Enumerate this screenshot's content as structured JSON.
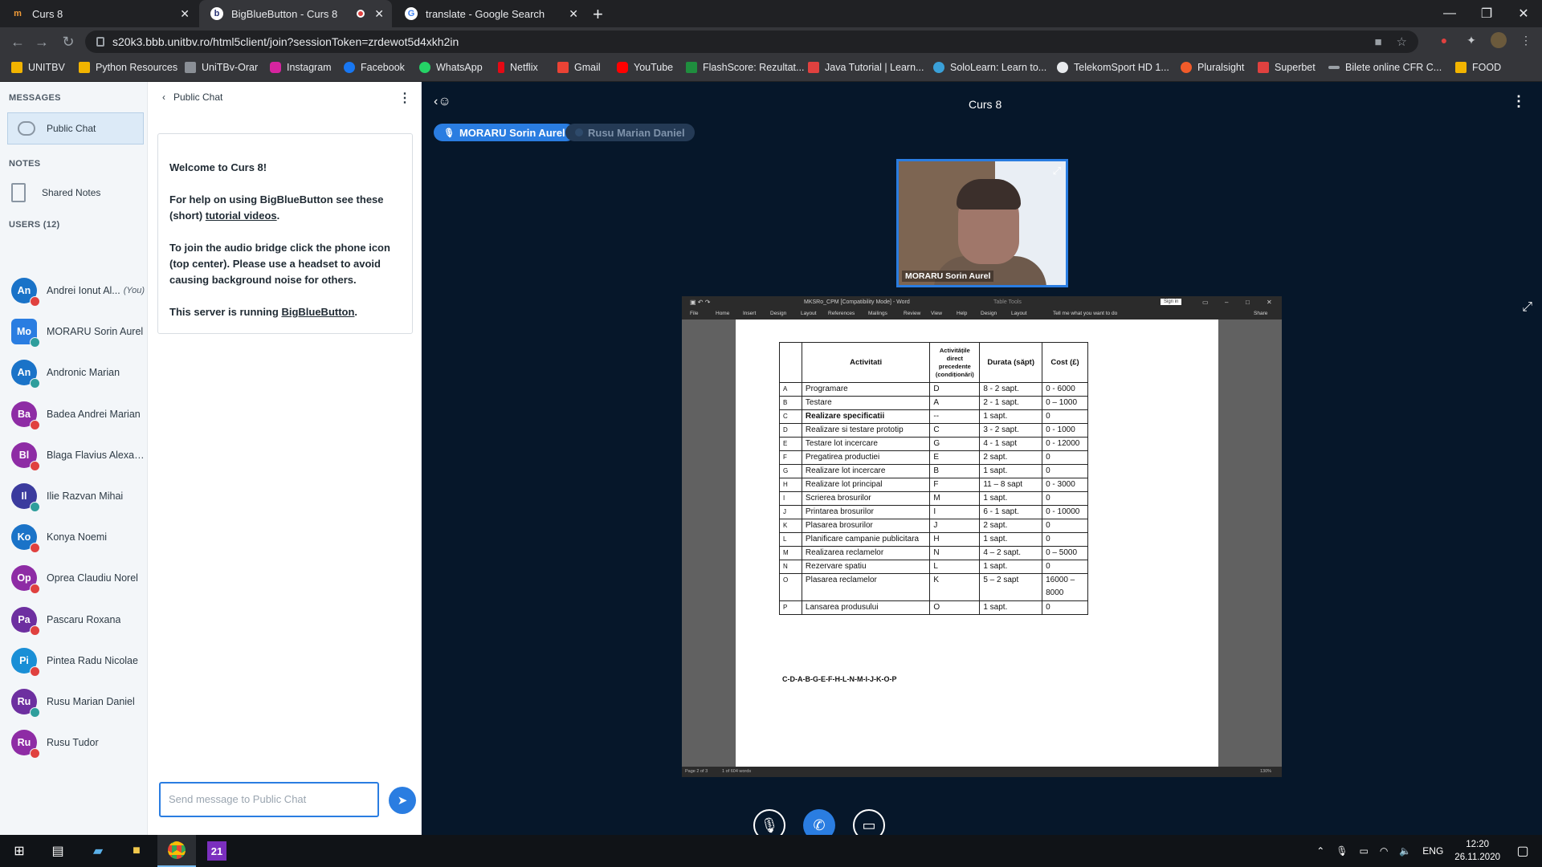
{
  "browser": {
    "tabs": [
      {
        "label": "Curs 8",
        "favicon": "m",
        "active": false
      },
      {
        "label": "BigBlueButton - Curs 8",
        "favicon": "b",
        "active": true
      },
      {
        "label": "translate - Google Search",
        "favicon": "G",
        "active": false
      }
    ],
    "url": "s20k3.bbb.unitbv.ro/html5client/join?sessionToken=zrdewot5d4xkh2in",
    "bookmarks": [
      "UNITBV",
      "Python Resources",
      "UniTBv-Orar",
      "Instagram",
      "Facebook",
      "WhatsApp",
      "Netflix",
      "Gmail",
      "YouTube",
      "FlashScore: Rezultat...",
      "Java Tutorial | Learn...",
      "SoloLearn: Learn to...",
      "TelekomSport HD 1...",
      "Pluralsight",
      "Superbet",
      "Bilete online CFR C...",
      "FOOD"
    ]
  },
  "sidebar": {
    "messages_title": "MESSAGES",
    "public_chat": "Public Chat",
    "notes_title": "NOTES",
    "shared_notes": "Shared Notes",
    "users_title": "USERS (12)",
    "you_label": "(You)",
    "users": [
      {
        "initials": "An",
        "name": "Andrei Ionut Al...",
        "color": "#1a73c8",
        "status": "#e0413f",
        "you": true,
        "square": false
      },
      {
        "initials": "Mo",
        "name": "MORARU Sorin Aurel",
        "color": "#2a7de1",
        "status": "#2e9e9c",
        "you": false,
        "square": true
      },
      {
        "initials": "An",
        "name": "Andronic Marian",
        "color": "#1a73c8",
        "status": "#2e9e9c",
        "you": false,
        "square": false
      },
      {
        "initials": "Ba",
        "name": "Badea Andrei Marian",
        "color": "#8e2ca5",
        "status": "#e0413f",
        "you": false,
        "square": false
      },
      {
        "initials": "Bl",
        "name": "Blaga Flavius Alexan...",
        "color": "#8e2ca5",
        "status": "#e0413f",
        "you": false,
        "square": false
      },
      {
        "initials": "Il",
        "name": "Ilie Razvan Mihai",
        "color": "#3b3b9e",
        "status": "#2e9e9c",
        "you": false,
        "square": false
      },
      {
        "initials": "Ko",
        "name": "Konya Noemi",
        "color": "#1a73c8",
        "status": "#e0413f",
        "you": false,
        "square": false
      },
      {
        "initials": "Op",
        "name": "Oprea Claudiu Norel",
        "color": "#8e2ca5",
        "status": "#e0413f",
        "you": false,
        "square": false
      },
      {
        "initials": "Pa",
        "name": "Pascaru Roxana",
        "color": "#6d2fa0",
        "status": "#e0413f",
        "you": false,
        "square": false
      },
      {
        "initials": "Pi",
        "name": "Pintea Radu Nicolae",
        "color": "#1a8fd6",
        "status": "#e0413f",
        "you": false,
        "square": false
      },
      {
        "initials": "Ru",
        "name": "Rusu Marian Daniel",
        "color": "#6d2fa0",
        "status": "#2e9e9c",
        "you": false,
        "square": false
      },
      {
        "initials": "Ru",
        "name": "Rusu Tudor",
        "color": "#8e2ca5",
        "status": "#e0413f",
        "you": false,
        "square": false
      }
    ]
  },
  "chat": {
    "title": "Public Chat",
    "welcome": "Welcome to Curs 8!",
    "help_prefix": "For help on using BigBlueButton see these (short) ",
    "help_link": "tutorial videos",
    "help_suffix": ".",
    "audio": "To join the audio bridge click the phone icon (top center). Please use a headset to avoid causing background noise for others.",
    "server_prefix": "This server is running ",
    "server_link": "BigBlueButton",
    "server_suffix": ".",
    "placeholder": "Send message to Public Chat"
  },
  "meeting": {
    "title": "Curs 8",
    "talker_active": "MORARU Sorin Aurel",
    "talker_inactive": "Rusu Marian Daniel",
    "webcam_name": "MORARU Sorin Aurel"
  },
  "word": {
    "doc_title": "MKSRo_CPM [Compatibility Mode] - Word",
    "table_tools": "Table Tools",
    "sign_in": "Sign in",
    "menu": [
      "File",
      "Home",
      "Insert",
      "Design",
      "Layout",
      "References",
      "Mailings",
      "Review",
      "View",
      "Help",
      "Design",
      "Layout",
      "Tell me what you want to do",
      "Share"
    ],
    "status_page": "Page 2 of 3",
    "status_words": "1 of 604 words",
    "zoom": "130%",
    "headers": [
      "Activitati",
      "Activitățile direct precedente (condiționări)",
      "Durata (săpt)",
      "Cost (£)"
    ],
    "rows": [
      [
        "A",
        "Programare",
        "D",
        "8 - 2 sapt.",
        "0 - 6000"
      ],
      [
        "B",
        "Testare",
        "A",
        "2 - 1 sapt.",
        "0 – 1000"
      ],
      [
        "C",
        "Realizare specificatii",
        "--",
        "1 sapt.",
        "0"
      ],
      [
        "D",
        "Realizare si testare prototip",
        "C",
        "3 - 2 sapt.",
        "0 - 1000"
      ],
      [
        "E",
        "Testare lot incercare",
        "G",
        "4 - 1 sapt",
        "0 - 12000"
      ],
      [
        "F",
        "Pregatirea productiei",
        "E",
        "2 sapt.",
        "0"
      ],
      [
        "G",
        "Realizare lot incercare",
        "B",
        "1 sapt.",
        "0"
      ],
      [
        "H",
        "Realizare lot principal",
        "F",
        "11 – 8 sapt",
        "0 - 3000"
      ],
      [
        "I",
        "Scrierea brosurilor",
        "M",
        "1 sapt.",
        "0"
      ],
      [
        "J",
        "Printarea brosurilor",
        "I",
        "6 - 1 sapt.",
        "0 - 10000"
      ],
      [
        "K",
        "Plasarea brosurilor",
        "J",
        "2 sapt.",
        "0"
      ],
      [
        "L",
        "Planificare campanie publicitara",
        "H",
        "1 sapt.",
        "0"
      ],
      [
        "M",
        "Realizarea reclamelor",
        "N",
        "4 – 2 sapt.",
        "0 – 5000"
      ],
      [
        "N",
        "Rezervare spatiu",
        "L",
        "1 sapt.",
        "0"
      ],
      [
        "O",
        "Plasarea reclamelor",
        "K",
        "5 – 2 sapt",
        "16000 – 8000"
      ],
      [
        "P",
        "Lansarea produsului",
        "O",
        "1 sapt.",
        "0"
      ]
    ],
    "sequence": "C-D-A-B-G-E-F-H-L-N-M-I-J-K-O-P"
  },
  "taskbar": {
    "lang": "ENG",
    "time": "12:20",
    "date": "26.11.2020"
  }
}
